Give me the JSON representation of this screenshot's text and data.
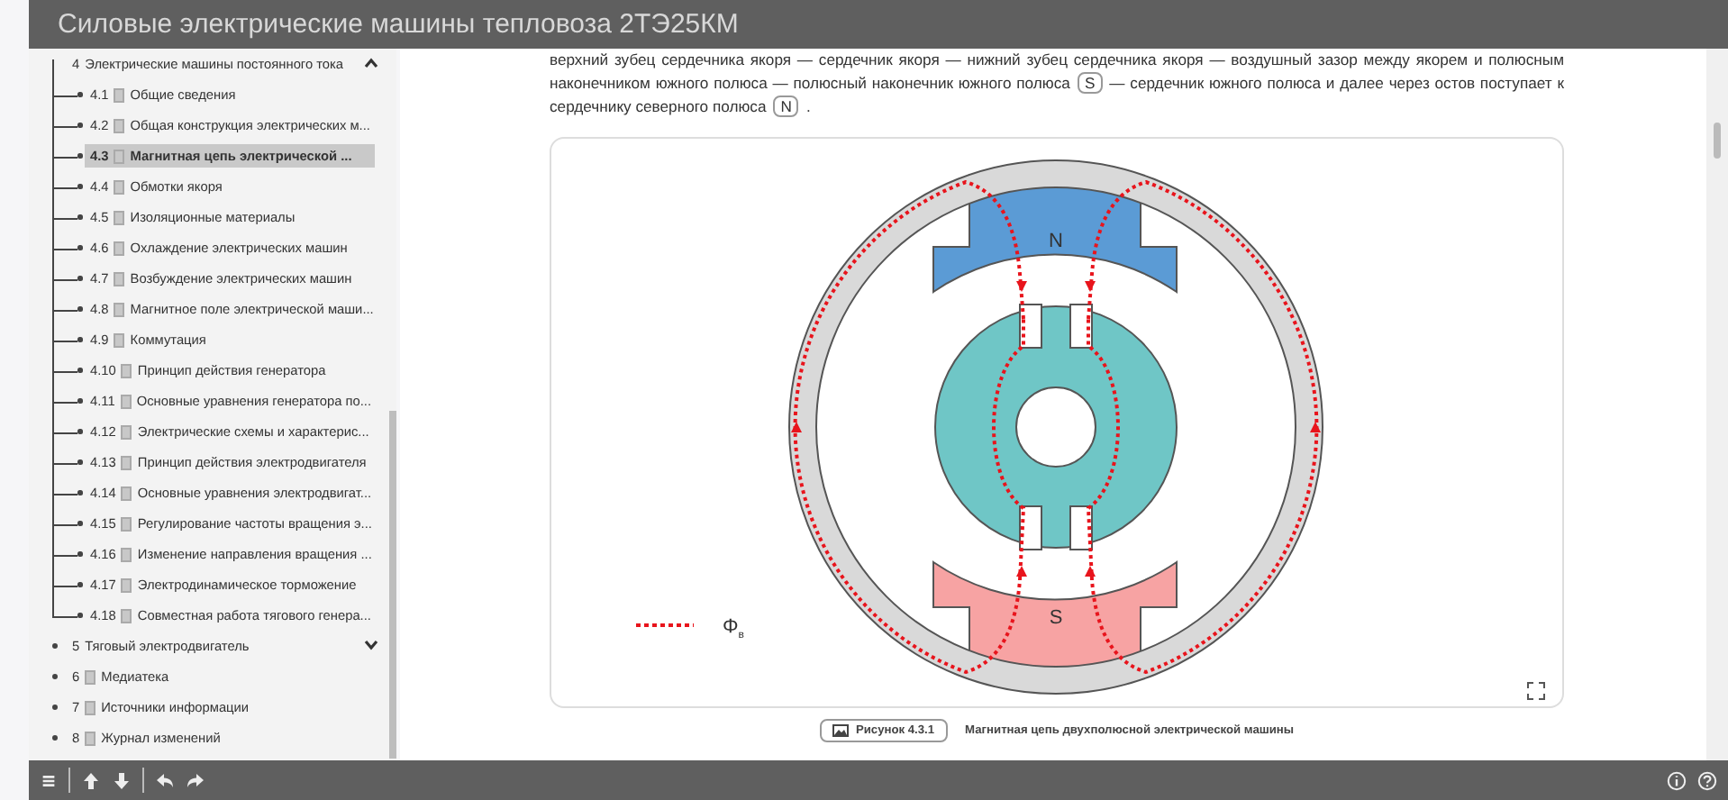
{
  "header": {
    "title": "Силовые электрические машины тепловоза 2ТЭ25КМ"
  },
  "sidebar": {
    "items": [
      {
        "kind": "section",
        "number": "4",
        "title": "Электрические машины постоянного тока",
        "expanded": true,
        "selected": false,
        "children": [
          {
            "number": "4.1",
            "title": "Общие сведения",
            "selected": false
          },
          {
            "number": "4.2",
            "title": "Общая конструкция электрических м...",
            "selected": false
          },
          {
            "number": "4.3",
            "title": "Магнитная цепь электрической ...",
            "selected": true
          },
          {
            "number": "4.4",
            "title": "Обмотки якоря",
            "selected": false
          },
          {
            "number": "4.5",
            "title": "Изоляционные материалы",
            "selected": false
          },
          {
            "number": "4.6",
            "title": "Охлаждение электрических машин",
            "selected": false
          },
          {
            "number": "4.7",
            "title": "Возбуждение электрических машин",
            "selected": false
          },
          {
            "number": "4.8",
            "title": "Магнитное поле электрической маши...",
            "selected": false
          },
          {
            "number": "4.9",
            "title": "Коммутация",
            "selected": false
          },
          {
            "number": "4.10",
            "title": "Принцип действия генератора",
            "selected": false
          },
          {
            "number": "4.11",
            "title": "Основные уравнения генератора по...",
            "selected": false
          },
          {
            "number": "4.12",
            "title": "Электрические схемы и характерис...",
            "selected": false
          },
          {
            "number": "4.13",
            "title": "Принцип действия электродвигателя",
            "selected": false
          },
          {
            "number": "4.14",
            "title": "Основные уравнения электродвигат...",
            "selected": false
          },
          {
            "number": "4.15",
            "title": "Регулирование частоты вращения э...",
            "selected": false
          },
          {
            "number": "4.16",
            "title": "Изменение направления вращения ...",
            "selected": false
          },
          {
            "number": "4.17",
            "title": "Электродинамическое торможение",
            "selected": false
          },
          {
            "number": "4.18",
            "title": "Совместная работа тягового генера...",
            "selected": false
          }
        ]
      },
      {
        "kind": "section",
        "number": "5",
        "title": "Тяговый электродвигатель",
        "expanded": false,
        "selected": false
      },
      {
        "kind": "page",
        "number": "6",
        "title": "Медиатека",
        "selected": false
      },
      {
        "kind": "page",
        "number": "7",
        "title": "Источники информации",
        "selected": false
      },
      {
        "kind": "page",
        "number": "8",
        "title": "Журнал изменений",
        "selected": false
      }
    ]
  },
  "content": {
    "paragraph": [
      {
        "kind": "text",
        "text": "верхний зубец сердечника якоря — сердечник якоря — нижний зубец сердечника якоря — воздушный зазор между якорем и полюсным наконечником южного полюса — полюсный наконечник южного полюса"
      },
      {
        "kind": "badge",
        "text": "S"
      },
      {
        "kind": "text",
        "text": "— сердечник южного полюса и далее через остов поступает к сердечнику северного полюса"
      },
      {
        "kind": "badge",
        "text": "N"
      },
      {
        "kind": "text",
        "text": "."
      }
    ],
    "figure": {
      "north_label": "N",
      "south_label": "S",
      "legend": {
        "symbol": "Φ",
        "subscript": "в"
      },
      "caption_button": "Рисунок 4.3.1",
      "caption": "Магнитная цепь двухполюсной электрической машины"
    }
  }
}
